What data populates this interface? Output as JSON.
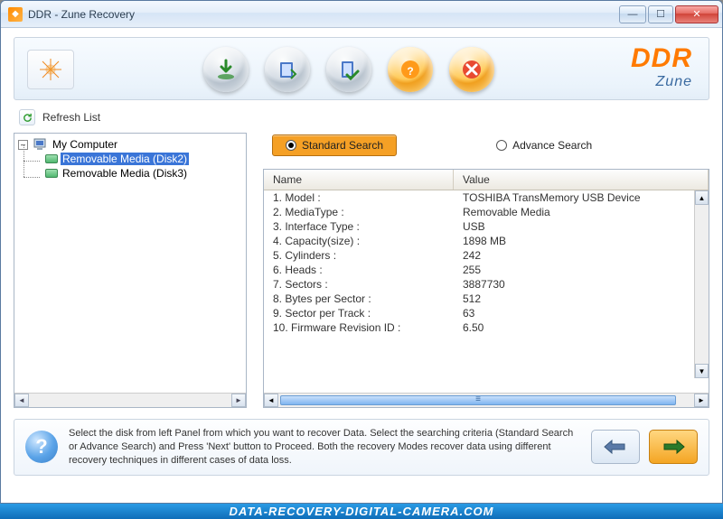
{
  "window": {
    "title": "DDR - Zune Recovery"
  },
  "brand": {
    "main": "DDR",
    "sub": "Zune"
  },
  "toolbar": {
    "buttons": [
      "load",
      "open",
      "verify",
      "help",
      "cancel"
    ]
  },
  "refresh": {
    "label": "Refresh List"
  },
  "tree": {
    "root": "My Computer",
    "items": [
      {
        "label": "Removable Media (Disk2)",
        "selected": true
      },
      {
        "label": "Removable Media (Disk3)",
        "selected": false
      }
    ]
  },
  "search": {
    "standard": "Standard Search",
    "advance": "Advance Search",
    "selected": "standard"
  },
  "details": {
    "headers": {
      "name": "Name",
      "value": "Value"
    },
    "rows": [
      {
        "n": "1. Model :",
        "v": "TOSHIBA TransMemory USB Device"
      },
      {
        "n": "2. MediaType :",
        "v": "Removable Media"
      },
      {
        "n": "3. Interface Type :",
        "v": "USB"
      },
      {
        "n": "4. Capacity(size) :",
        "v": "1898 MB"
      },
      {
        "n": "5. Cylinders :",
        "v": "242"
      },
      {
        "n": "6. Heads :",
        "v": "255"
      },
      {
        "n": "7. Sectors :",
        "v": "3887730"
      },
      {
        "n": "8. Bytes per Sector :",
        "v": "512"
      },
      {
        "n": "9. Sector per Track :",
        "v": "63"
      },
      {
        "n": "10. Firmware Revision ID :",
        "v": "6.50"
      }
    ]
  },
  "help": {
    "text": "Select the disk from left Panel from which you want to recover Data. Select the searching criteria (Standard Search or Advance Search) and Press 'Next' button to Proceed. Both the recovery Modes recover data using different recovery techniques in different cases of data loss."
  },
  "footer": {
    "text": "DATA-RECOVERY-DIGITAL-CAMERA.COM"
  }
}
